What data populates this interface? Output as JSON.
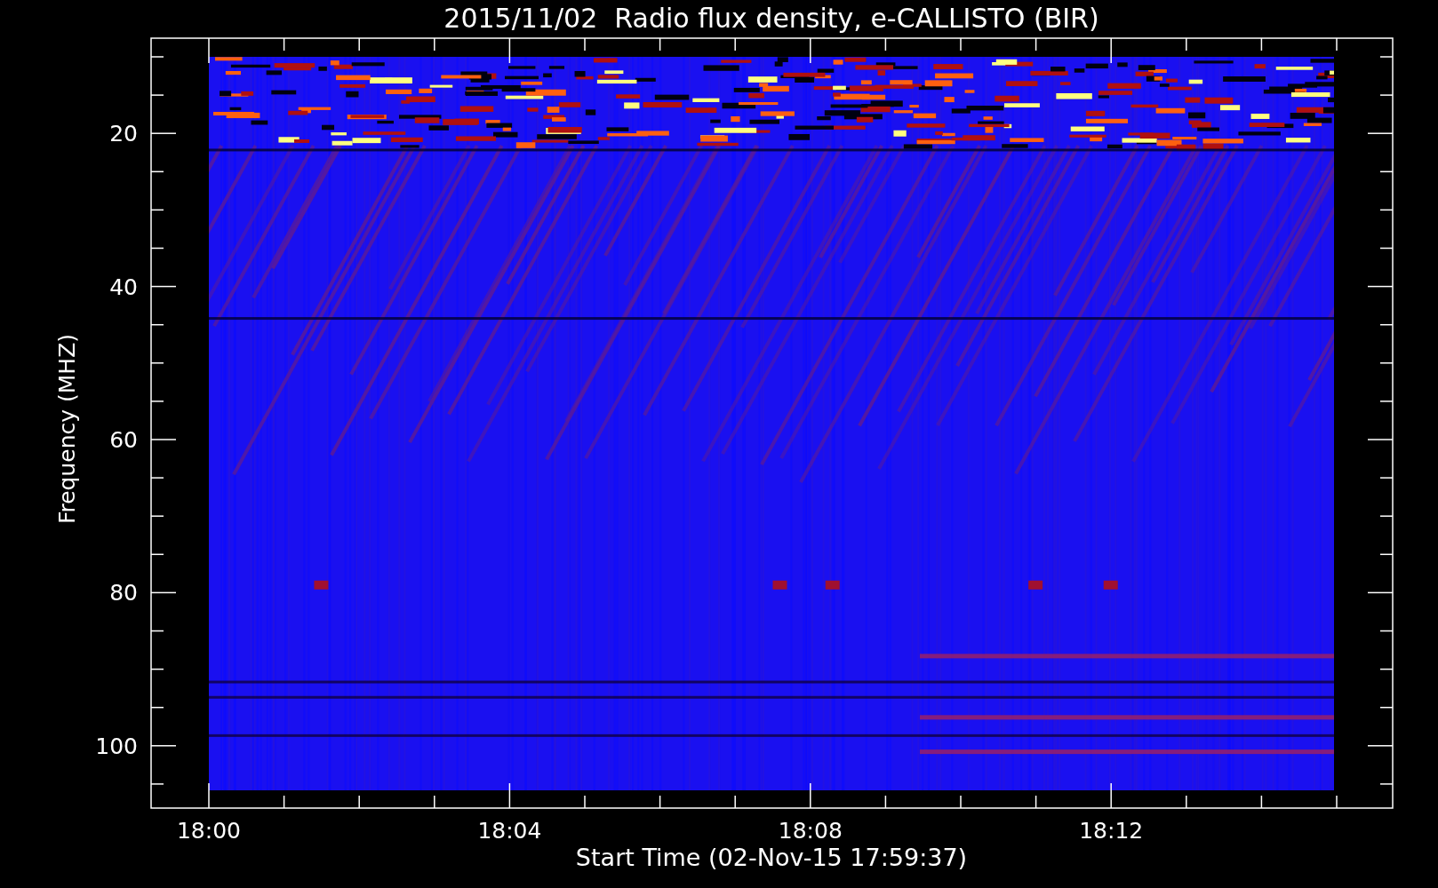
{
  "title": "2015/11/02  Radio flux density, e-CALLISTO (BIR)",
  "y_axis": {
    "label": "Frequency (MHZ)",
    "ticks": [
      "20",
      "40",
      "60",
      "80",
      "100"
    ]
  },
  "x_axis": {
    "label": "Start Time (02-Nov-15 17:59:37)",
    "ticks": [
      "18:00",
      "18:04",
      "18:08",
      "18:12"
    ]
  }
}
